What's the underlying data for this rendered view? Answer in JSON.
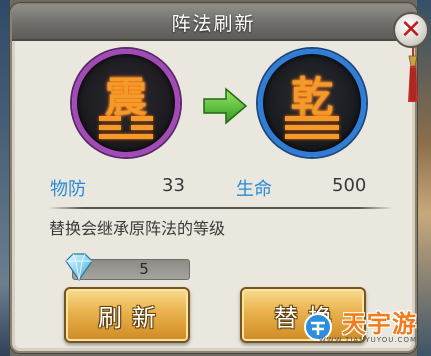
{
  "dialog": {
    "title": "阵法刷新",
    "close_icon": "close-icon"
  },
  "current_formation": {
    "glyph": "震",
    "trigram": "zhen",
    "ring_color": "#a24bb8",
    "stat_label": "物防",
    "stat_value": "33"
  },
  "new_formation": {
    "glyph": "乾",
    "trigram": "qian",
    "ring_color": "#2e7ed8",
    "stat_label": "生命",
    "stat_value": "500"
  },
  "notice": "替换会继承原阵法的等级",
  "cost": {
    "icon": "diamond-icon",
    "amount": "5"
  },
  "buttons": {
    "refresh_label": "刷新",
    "replace_label": "替换"
  },
  "watermark": {
    "main": "天宇游",
    "sub": "WWW.TIANYUYOU.COM"
  },
  "colors": {
    "stat_label": "#2a8ad6",
    "button_gold": "#e9b14c",
    "glyph_orange": "#f29a2a"
  }
}
